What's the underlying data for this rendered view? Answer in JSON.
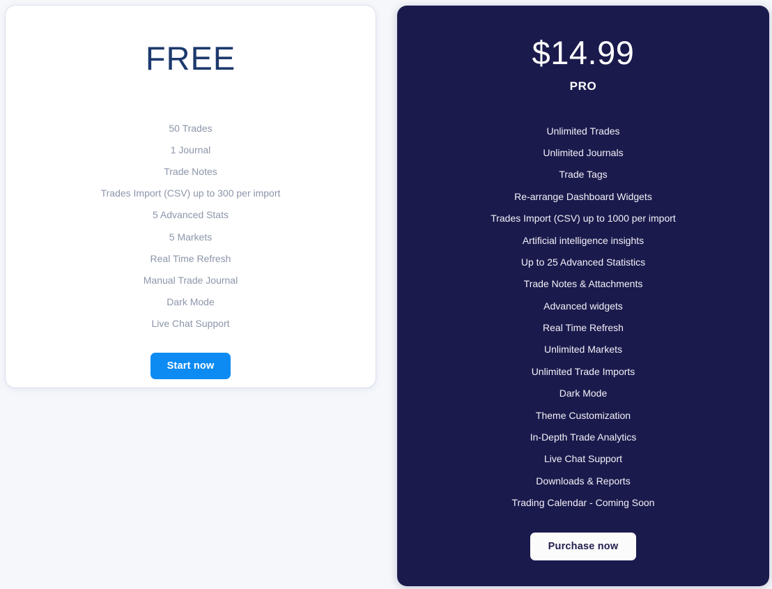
{
  "page": {
    "background_color": "#f5f7fb"
  },
  "plans": {
    "free": {
      "title": "FREE",
      "title_color": "#1d3a6d",
      "card_background": "#ffffff",
      "feature_color": "#8c95a9",
      "features": [
        "50 Trades",
        "1 Journal",
        "Trade Notes",
        "Trades Import (CSV) up to 300 per import",
        "5 Advanced Stats",
        "5 Markets",
        "Real Time Refresh",
        "Manual Trade Journal",
        "Dark Mode",
        "Live Chat Support"
      ],
      "cta": {
        "label": "Start now",
        "background_color": "#0d8bf2",
        "text_color": "#ffffff"
      }
    },
    "pro": {
      "price": "$14.99",
      "label": "PRO",
      "card_background": "#1b1a4d",
      "feature_color": "#f2f2f8",
      "features": [
        "Unlimited Trades",
        "Unlimited Journals",
        "Trade Tags",
        "Re-arrange Dashboard Widgets",
        "Trades Import (CSV) up to 1000 per import",
        "Artificial intelligence insights",
        "Up to 25 Advanced Statistics",
        "Trade Notes & Attachments",
        "Advanced widgets",
        "Real Time Refresh",
        "Unlimited Markets",
        "Unlimited Trade Imports",
        "Dark Mode",
        "Theme Customization",
        "In-Depth Trade Analytics",
        "Live Chat Support",
        "Downloads & Reports",
        "Trading Calendar - Coming Soon"
      ],
      "cta": {
        "label": "Purchase now",
        "background_color": "#fbfbfb",
        "text_color": "#23204f"
      }
    }
  }
}
